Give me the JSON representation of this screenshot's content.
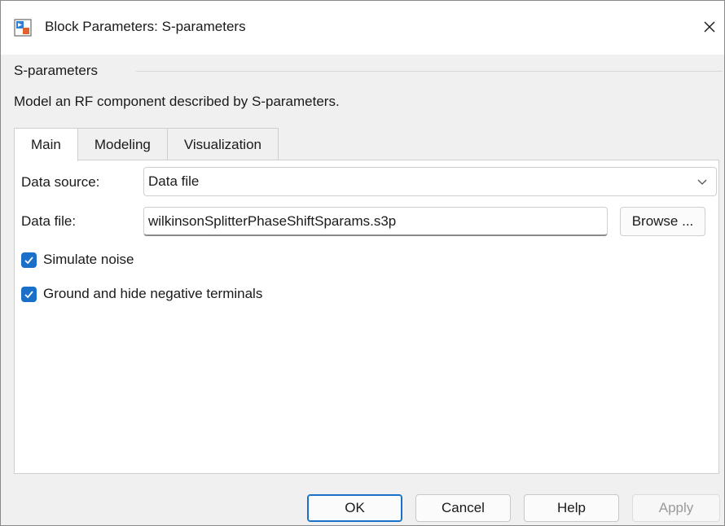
{
  "window": {
    "title": "Block Parameters: S-parameters",
    "icon": "simulink-block-icon",
    "close_icon": "close-icon"
  },
  "group": {
    "legend": "S-parameters",
    "description": "Model an RF component described by S-parameters."
  },
  "tabs": [
    {
      "label": "Main",
      "active": true
    },
    {
      "label": "Modeling",
      "active": false
    },
    {
      "label": "Visualization",
      "active": false
    }
  ],
  "main": {
    "data_source_label": "Data source:",
    "data_source_value": "Data file",
    "data_file_label": "Data file:",
    "data_file_value": "wilkinsonSplitterPhaseShiftSparams.s3p",
    "browse_label": "Browse ...",
    "simulate_noise_label": "Simulate noise",
    "simulate_noise_checked": true,
    "ground_label": "Ground and hide negative terminals",
    "ground_checked": true
  },
  "footer": {
    "ok_label": "OK",
    "cancel_label": "Cancel",
    "help_label": "Help",
    "apply_label": "Apply"
  },
  "colors": {
    "accent": "#1a6fc9",
    "dialog_bg": "#f0f0f0"
  }
}
